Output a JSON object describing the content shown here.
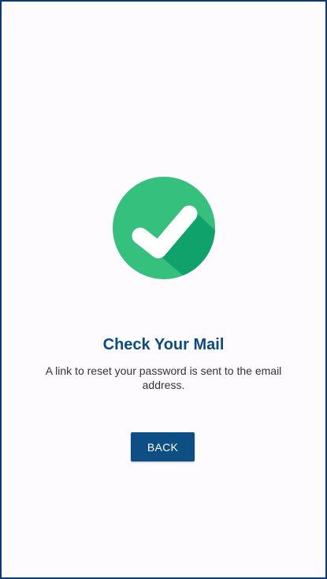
{
  "screen": {
    "icon": "check-circle-icon",
    "title": "Check Your Mail",
    "message": "A link to reset your password is sent to the email address.",
    "back_label": "BACK"
  },
  "colors": {
    "title": "#0a4c82",
    "button": "#0d4f85",
    "border": "#0b3a72",
    "icon_green": "#36c07e",
    "icon_shadow": "#0fa36b"
  }
}
